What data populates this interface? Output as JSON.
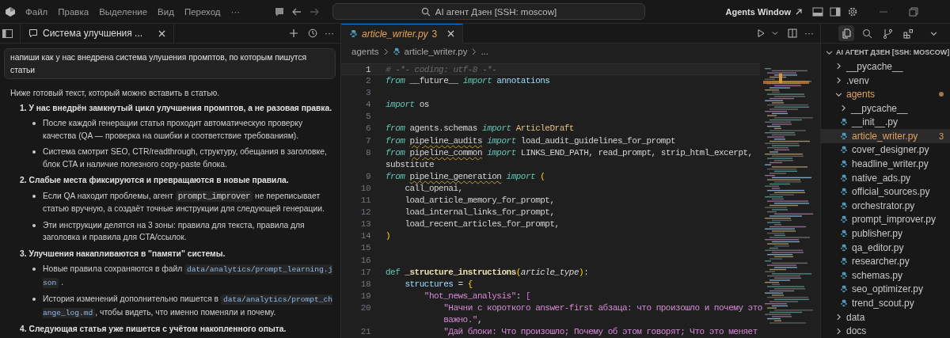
{
  "title_bar": {
    "menu": [
      "Файл",
      "Правка",
      "Выделение",
      "Вид",
      "Переход"
    ],
    "more": "···",
    "search": "AI агент Дзен [SSH: moscow]",
    "agents_window": "Agents Window"
  },
  "chat": {
    "tab": "Система улучшения ...",
    "more": "···",
    "user_message": "напиши как у нас внедрена система улушения промптов, по которым пишутся статьи",
    "intro": "Ниже готовый текст, который можно вставить в статью.",
    "items": [
      {
        "number": "1.",
        "heading": "У нас внедрён замкнутый цикл улучшения промптов, а не разовая правка.",
        "bullets": [
          {
            "parts": [
              {
                "kind": "text",
                "text": "После каждой генерации статья проходит автоматическую проверку качества (QA — проверка на ошибки и соответствие требованиям)."
              }
            ]
          },
          {
            "parts": [
              {
                "kind": "text",
                "text": "Система смотрит SEO, CTR/readthrough, структуру, обещания в заголовке, блок CTA и наличие полезного copy-paste блока."
              }
            ]
          }
        ]
      },
      {
        "number": "2.",
        "heading": "Слабые места фиксируются и превращаются в новые правила.",
        "bullets": [
          {
            "parts": [
              {
                "kind": "text",
                "text": "Если QA находит проблемы, агент "
              },
              {
                "kind": "code",
                "text": "prompt_improver"
              },
              {
                "kind": "text",
                "text": " не переписывает статью вручную, а создаёт точные инструкции для следующей генерации."
              }
            ]
          },
          {
            "parts": [
              {
                "kind": "text",
                "text": "Эти инструкции делятся на 3 зоны: правила для текста, правила для заголовка и правила для CTA/ссылок."
              }
            ]
          }
        ]
      },
      {
        "number": "3.",
        "heading": "Улучшения накапливаются в \"памяти\" системы.",
        "bullets": [
          {
            "parts": [
              {
                "kind": "text",
                "text": "Новые правила сохраняются в файл "
              },
              {
                "kind": "path",
                "text": "data/analytics/prompt_learning.json"
              },
              {
                "kind": "text",
                "text": " ."
              }
            ]
          },
          {
            "parts": [
              {
                "kind": "text",
                "text": "История изменений дополнительно пишется в "
              },
              {
                "kind": "path",
                "text": "data/analytics/prompt_change_log.md"
              },
              {
                "kind": "text",
                "text": ", чтобы видеть, что именно поменяли и почему."
              }
            ]
          }
        ]
      },
      {
        "number": "4.",
        "heading": "Следующая статья уже пишется с учётом накопленного опыта."
      }
    ]
  },
  "editor": {
    "tab": {
      "name": "article_writer.py",
      "problems": "3"
    },
    "more": "···",
    "breadcrumb": [
      {
        "kind": "folder",
        "text": "agents"
      },
      {
        "kind": "file",
        "text": "article_writer.py"
      },
      {
        "kind": "more",
        "text": "..."
      }
    ],
    "lines": [
      {
        "num": "1",
        "current": true,
        "tokens": [
          {
            "kind": "comment",
            "text": "# -*- coding: utf-8 -*-"
          }
        ]
      },
      {
        "num": "2",
        "current": false,
        "tokens": [
          {
            "kind": "kw",
            "text": "from"
          },
          {
            "kind": "plain",
            "text": " __future__ "
          },
          {
            "kind": "kw",
            "text": "import"
          },
          {
            "kind": "var",
            "text": " annotations"
          }
        ]
      },
      {
        "num": "3",
        "current": false
      },
      {
        "num": "4",
        "current": false,
        "tokens": [
          {
            "kind": "kw",
            "text": "import"
          },
          {
            "kind": "plain",
            "text": " os"
          }
        ]
      },
      {
        "num": "5",
        "current": false
      },
      {
        "num": "6",
        "current": false,
        "tokens": [
          {
            "kind": "kw",
            "text": "from"
          },
          {
            "kind": "plain",
            "text": " agents.schemas "
          },
          {
            "kind": "kw",
            "text": "import"
          },
          {
            "kind": "cls",
            "text": " ArticleDraft"
          }
        ]
      },
      {
        "num": "7",
        "current": false,
        "tokens": [
          {
            "kind": "kw",
            "text": "from "
          },
          {
            "kind": "warn",
            "text": "pipeline_audits"
          },
          {
            "kind": "kw",
            "text": " import"
          },
          {
            "kind": "plain",
            "text": " load_audit_guidelines_for_prompt"
          }
        ]
      },
      {
        "num": "8",
        "current": false,
        "tokens": [
          {
            "kind": "kw",
            "text": "from "
          },
          {
            "kind": "warn",
            "text": "pipeline_common"
          },
          {
            "kind": "kw",
            "text": " import"
          },
          {
            "kind": "plain",
            "text": " LINKS_END_PATH, read_prompt, strip_html_excerpt,"
          }
        ]
      },
      {
        "current": false,
        "tokens": [
          {
            "kind": "plain",
            "text": "substitute"
          }
        ]
      },
      {
        "num": "9",
        "current": false,
        "tokens": [
          {
            "kind": "kw",
            "text": "from "
          },
          {
            "kind": "warn",
            "text": "pipeline_generation"
          },
          {
            "kind": "kw",
            "text": " import"
          },
          {
            "kind": "br1",
            "text": " ("
          }
        ]
      },
      {
        "num": "10",
        "current": false,
        "tokens": [
          {
            "kind": "plain",
            "text": "    call_openai,"
          }
        ]
      },
      {
        "num": "11",
        "current": false,
        "tokens": [
          {
            "kind": "plain",
            "text": "    load_article_memory_for_prompt,"
          }
        ]
      },
      {
        "num": "12",
        "current": false,
        "tokens": [
          {
            "kind": "plain",
            "text": "    load_internal_links_for_prompt,"
          }
        ]
      },
      {
        "num": "13",
        "current": false,
        "tokens": [
          {
            "kind": "plain",
            "text": "    load_recent_articles_for_prompt,"
          }
        ]
      },
      {
        "num": "14",
        "current": false,
        "tokens": [
          {
            "kind": "br1",
            "text": ")"
          }
        ]
      },
      {
        "num": "15",
        "current": false
      },
      {
        "num": "16",
        "current": false
      },
      {
        "num": "17",
        "current": false,
        "tokens": [
          {
            "kind": "def",
            "text": "def "
          },
          {
            "kind": "fn",
            "text": "_structure_instructions"
          },
          {
            "kind": "br1",
            "text": "("
          },
          {
            "kind": "param",
            "text": "article_type"
          },
          {
            "kind": "br1",
            "text": ")"
          },
          {
            "kind": "plain",
            "text": ":"
          }
        ]
      },
      {
        "num": "18",
        "current": false,
        "tokens": [
          {
            "kind": "var",
            "text": "    structures"
          },
          {
            "kind": "plain",
            "text": " = "
          },
          {
            "kind": "br1",
            "text": "{"
          }
        ]
      },
      {
        "num": "19",
        "current": false,
        "tokens": [
          {
            "kind": "str",
            "text": "        \"hot_news_analysis\""
          },
          {
            "kind": "plain",
            "text": ": "
          },
          {
            "kind": "br2",
            "text": "["
          }
        ]
      },
      {
        "num": "20",
        "current": false,
        "tokens": [
          {
            "kind": "str",
            "text": "            \"Начни с короткого answer-first абзаца: что произошло и почему это"
          }
        ]
      },
      {
        "current": false,
        "tokens": [
          {
            "kind": "str",
            "text": "            важно.\""
          },
          {
            "kind": "plain",
            "text": ","
          }
        ]
      },
      {
        "num": "21",
        "current": false,
        "tokens": [
          {
            "kind": "str",
            "text": "            \"Дай блоки: Что произошло; Почему об этом говорят; Что это меняет"
          }
        ]
      }
    ]
  },
  "explorer": {
    "views": [
      {
        "kind": "explorer",
        "selected": true
      },
      {
        "kind": "search",
        "selected": false
      },
      {
        "kind": "source-control",
        "selected": false
      },
      {
        "kind": "extensions",
        "selected": false
      }
    ],
    "root": {
      "label": "AI АГЕНТ ДЗЕН [SSH: MOSCOW]",
      "expanded": true
    },
    "items": [
      {
        "kind": "folder",
        "name": "__pycache__",
        "expanded": false,
        "selected": false,
        "modified": false
      },
      {
        "kind": "folder",
        "name": ".venv",
        "expanded": false,
        "selected": false,
        "modified": false
      },
      {
        "kind": "folder",
        "name": "agents",
        "expanded": true,
        "selected": false,
        "modified": true,
        "children": [
          {
            "kind": "folder",
            "name": "__pycache__",
            "expanded": false,
            "selected": false,
            "modified": false
          },
          {
            "kind": "file",
            "name": "__init__.py",
            "selected": false,
            "modified": false
          },
          {
            "kind": "file",
            "name": "article_writer.py",
            "selected": true,
            "modified": true,
            "badge": "3"
          },
          {
            "kind": "file",
            "name": "cover_designer.py",
            "selected": false,
            "modified": false
          },
          {
            "kind": "file",
            "name": "headline_writer.py",
            "selected": false,
            "modified": false
          },
          {
            "kind": "file",
            "name": "native_ads.py",
            "selected": false,
            "modified": false
          },
          {
            "kind": "file",
            "name": "official_sources.py",
            "selected": false,
            "modified": false
          },
          {
            "kind": "file",
            "name": "orchestrator.py",
            "selected": false,
            "modified": false
          },
          {
            "kind": "file",
            "name": "prompt_improver.py",
            "selected": false,
            "modified": false
          },
          {
            "kind": "file",
            "name": "publisher.py",
            "selected": false,
            "modified": false
          },
          {
            "kind": "file",
            "name": "qa_editor.py",
            "selected": false,
            "modified": false
          },
          {
            "kind": "file",
            "name": "researcher.py",
            "selected": false,
            "modified": false
          },
          {
            "kind": "file",
            "name": "schemas.py",
            "selected": false,
            "modified": false
          },
          {
            "kind": "file",
            "name": "seo_optimizer.py",
            "selected": false,
            "modified": false
          },
          {
            "kind": "file",
            "name": "trend_scout.py",
            "selected": false,
            "modified": false
          }
        ]
      },
      {
        "kind": "folder",
        "name": "data",
        "expanded": false,
        "selected": false,
        "modified": false
      },
      {
        "kind": "folder",
        "name": "docs",
        "expanded": false,
        "selected": false,
        "modified": false
      }
    ]
  }
}
